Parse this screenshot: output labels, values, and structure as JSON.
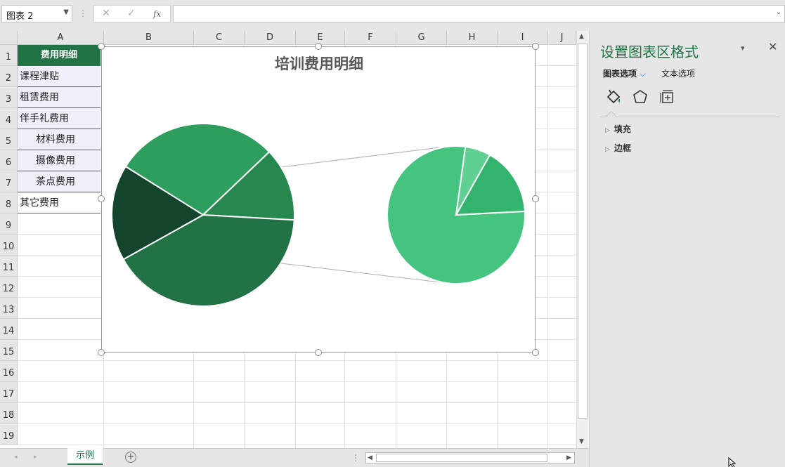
{
  "formula_bar": {
    "name_box": "图表 2",
    "dots": "⋮",
    "cancel_icon": "✕",
    "enter_icon": "✓",
    "fx_label": "fx",
    "formula": ""
  },
  "sheet": {
    "columns": [
      "A",
      "B",
      "C",
      "D",
      "E",
      "F",
      "G",
      "H",
      "I",
      "J"
    ],
    "rows": [
      "1",
      "2",
      "3",
      "4",
      "5",
      "6",
      "7",
      "8",
      "9",
      "10",
      "11",
      "12",
      "13",
      "14",
      "15",
      "16",
      "17",
      "18",
      "19"
    ],
    "cells": [
      "费用明细",
      "课程津贴",
      "租赁费用",
      "伴手礼费用",
      "材料费用",
      "摄像费用",
      "茶点费用",
      "其它费用"
    ],
    "tab_name": "示例",
    "add_sheet": "+"
  },
  "chart": {
    "title": "培训费用明细",
    "colors": {
      "main_slices": [
        "#2e9e5e",
        "#26874f",
        "#217346",
        "#13452d"
      ],
      "secondary_slices": [
        "#44c47f",
        "#5fd092",
        "#33b46c"
      ],
      "connector": "#b0b0b0"
    }
  },
  "chart_data": {
    "type": "pie",
    "subtype": "pie-of-pie",
    "title": "培训费用明细",
    "main_pie": {
      "values": [
        29,
        13,
        41,
        17
      ]
    },
    "secondary_pie": {
      "values": [
        78,
        6,
        16
      ]
    }
  },
  "pane": {
    "title": "设置图表区格式",
    "dropdown_icon": "▾",
    "close_icon": "✕",
    "tab_chart_options": "图表选项",
    "tab_chevron": "⌵",
    "tab_text_options": "文本选项",
    "sections": [
      "填充",
      "边框"
    ]
  }
}
